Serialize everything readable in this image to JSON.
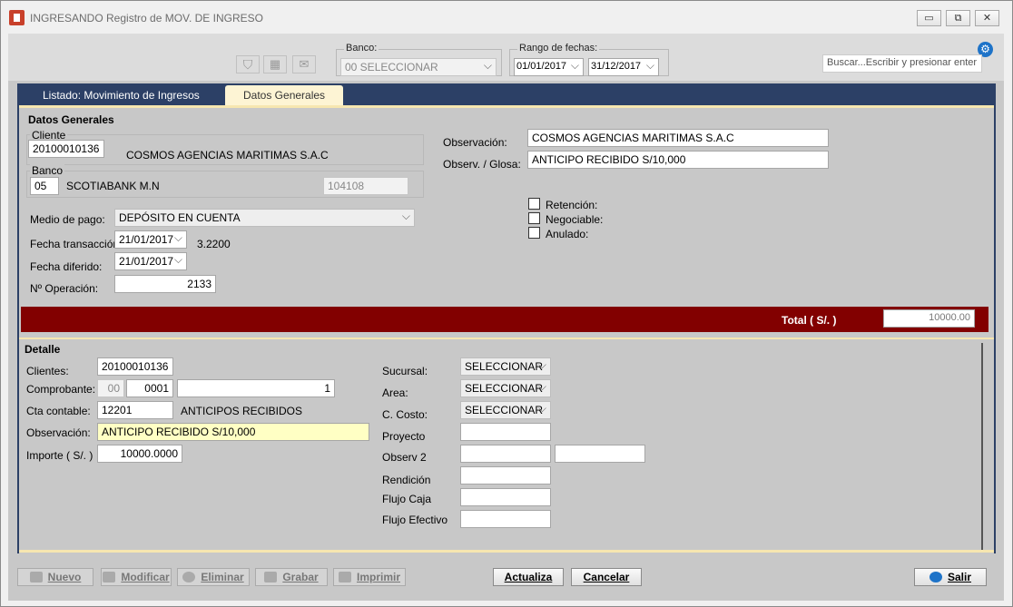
{
  "window": {
    "title": "INGRESANDO Registro de MOV. DE INGRESO"
  },
  "toolbar": {
    "banco_label": "Banco:",
    "banco_value": "00 SELECCIONAR",
    "rango_label": "Rango de fechas:",
    "fecha_desde": "01/01/2017",
    "fecha_hasta": "31/12/2017",
    "search_placeholder": "Buscar...Escribir y presionar enter"
  },
  "tabs": [
    {
      "label": "Listado: Movimiento de Ingresos"
    },
    {
      "label": "Datos Generales"
    }
  ],
  "datos_generales": {
    "title": "Datos Generales",
    "cliente_legend": "Cliente",
    "cliente_codigo": "20100010136",
    "cliente_nombre": "COSMOS AGENCIAS MARITIMAS S.A.C",
    "banco_legend": "Banco",
    "banco_codigo": "05",
    "banco_nombre": "SCOTIABANK M.N",
    "banco_cuenta": "104108",
    "medio_pago_label": "Medio de pago:",
    "medio_pago_value": "DEPÓSITO EN CUENTA",
    "fecha_transaccion_label": "Fecha transacción:",
    "fecha_transaccion_value": "21/01/2017",
    "tipo_cambio": "3.2200",
    "fecha_diferido_label": "Fecha diferido:",
    "fecha_diferido_value": "21/01/2017",
    "operacion_label": "Nº Operación:",
    "operacion_value": "2133",
    "observacion_label": "Observación:",
    "observacion_value": "COSMOS AGENCIAS MARITIMAS S.A.C",
    "glosa_label": "Observ. / Glosa:",
    "glosa_value": "ANTICIPO RECIBIDO S/10,000",
    "retencion_label": "Retención:",
    "negociable_label": "Negociable:",
    "anulado_label": "Anulado:",
    "total_label": "Total ( S/. )",
    "total_value": "10000.00"
  },
  "detalle": {
    "title": "Detalle",
    "clientes_label": "Clientes:",
    "clientes_value": "20100010136",
    "comprobante_label": "Comprobante:",
    "comprobante_tipo": "00",
    "comprobante_serie": "0001",
    "comprobante_numero": "1",
    "cta_label": "Cta contable:",
    "cta_value": "12201",
    "cta_nombre": "ANTICIPOS RECIBIDOS",
    "observacion_label": "Observación:",
    "observacion_value": "ANTICIPO RECIBIDO S/10,000",
    "importe_label": "Importe ( S/. )",
    "importe_value": "10000.0000",
    "sucursal_label": "Sucursal:",
    "sucursal_value": "SELECCIONAR",
    "area_label": "Area:",
    "area_value": "SELECCIONAR",
    "costo_label": "C. Costo:",
    "costo_value": "SELECCIONAR",
    "proyecto_label": "Proyecto",
    "observ2_label": "Observ 2",
    "rendicion_label": "Rendición",
    "flujo_caja_label": "Flujo Caja",
    "flujo_efectivo_label": "Flujo Efectivo"
  },
  "buttons": {
    "nuevo": "Nuevo",
    "modificar": "Modificar",
    "eliminar": "Eliminar",
    "grabar": "Grabar",
    "imprimir": "Imprimir",
    "actualiza": "Actualiza",
    "cancelar": "Cancelar",
    "salir": "Salir"
  }
}
